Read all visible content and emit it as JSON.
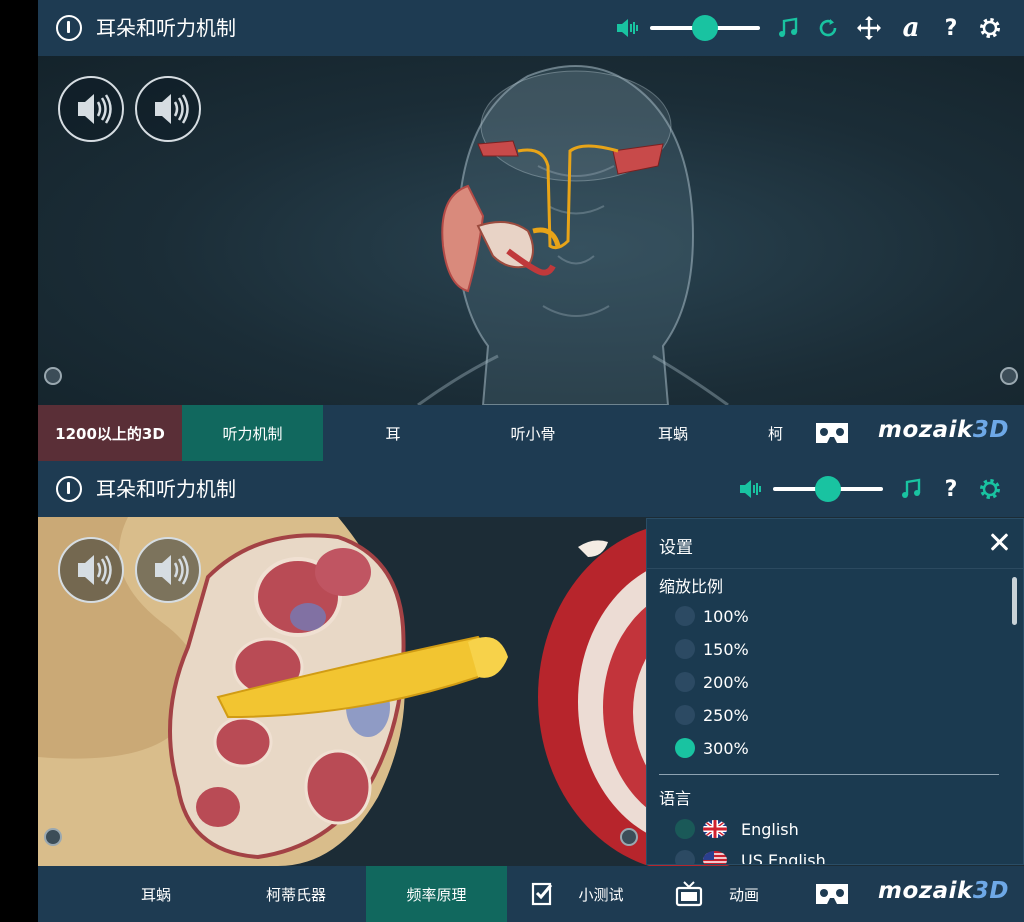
{
  "top": {
    "title": "耳朵和听力机制",
    "toolbar_icons": [
      "volume-icon",
      "music-icon",
      "reset-icon",
      "move-icon",
      "font-icon",
      "help-icon",
      "gear-icon"
    ],
    "volume_level": 0.5,
    "tabs": [
      {
        "label": "1200以上的3D",
        "state": "special"
      },
      {
        "label": "听力机制",
        "state": "active"
      },
      {
        "label": "耳",
        "state": "normal"
      },
      {
        "label": "听小骨",
        "state": "normal"
      },
      {
        "label": "耳蜗",
        "state": "normal"
      },
      {
        "label": "柯",
        "state": "normal"
      }
    ],
    "brand": {
      "logo_text": "mozaik",
      "logo_suffix": "3D"
    }
  },
  "bottom": {
    "title": "耳朵和听力机制",
    "toolbar_icons": [
      "volume-icon",
      "music-icon",
      "help-icon",
      "gear-icon"
    ],
    "volume_level": 0.5,
    "tabs": [
      {
        "label": "耳蜗",
        "state": "normal"
      },
      {
        "label": "柯蒂氏器",
        "state": "normal"
      },
      {
        "label": "频率原理",
        "state": "active"
      },
      {
        "label": "小测试",
        "state": "normal",
        "icon": "quiz-icon"
      },
      {
        "label": "动画",
        "state": "normal",
        "icon": "tv-icon"
      }
    ],
    "brand": {
      "logo_text": "mozaik",
      "logo_suffix": "3D"
    },
    "settings": {
      "title": "设置",
      "zoom_label": "缩放比例",
      "zoom_options": [
        "100%",
        "150%",
        "200%",
        "250%",
        "300%"
      ],
      "zoom_selected": "300%",
      "language_label": "语言",
      "languages": [
        "English",
        "US English"
      ],
      "language_selected": "English"
    }
  },
  "colors": {
    "accent": "#19c3a1",
    "bar": "#1e3b52",
    "active_tab": "#11685e",
    "special_tab": "#5a2f37",
    "logo_3d": "#6ea8e6"
  }
}
